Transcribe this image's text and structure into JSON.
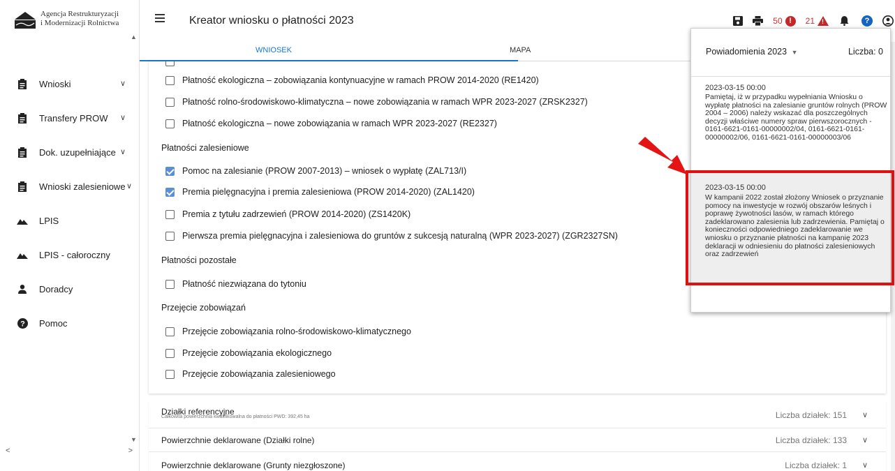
{
  "sidebar": {
    "logo_line1": "Agencja Restrukturyzacji",
    "logo_line2": "i Modernizacji Rolnictwa",
    "items": [
      {
        "label": "Wnioski",
        "icon": "clipboard-icon",
        "has_chevron": true
      },
      {
        "label": "Transfery PROW",
        "icon": "clipboard-icon",
        "has_chevron": true
      },
      {
        "label": "Dok. uzupełniające",
        "icon": "clipboard-icon",
        "has_chevron": true
      },
      {
        "label": "Wnioski zalesieniowe",
        "icon": "clipboard-icon",
        "has_chevron": true
      },
      {
        "label": "LPIS",
        "icon": "terrain-icon",
        "has_chevron": false
      },
      {
        "label": "LPIS - całoroczny",
        "icon": "terrain-icon",
        "has_chevron": false
      },
      {
        "label": "Doradcy",
        "icon": "person-icon",
        "has_chevron": false
      },
      {
        "label": "Pomoc",
        "icon": "help-icon",
        "has_chevron": false
      }
    ]
  },
  "header": {
    "title": "Kreator wniosku o płatności 2023",
    "errors_count": "50",
    "warnings_count": "21"
  },
  "tabs": {
    "wniosek": "WNIOSEK",
    "mapa": "MAPA"
  },
  "form": {
    "options_top": [
      {
        "label": "Płatność ekologiczna – zobowiązania kontynuacyjne w ramach PROW 2014-2020 (RE1420)",
        "checked": false
      },
      {
        "label": "Płatność rolno-środowiskowo-klimatyczna – nowe zobowiązania w ramach WPR 2023-2027 (ZRSK2327)",
        "checked": false
      },
      {
        "label": "Płatność ekologiczna – nowe zobowiązania w ramach WPR 2023-2027 (RE2327)",
        "checked": false
      }
    ],
    "section_zalesieniowe": "Płatności zalesieniowe",
    "options_zalesieniowe": [
      {
        "label": "Pomoc na zalesianie (PROW 2007-2013) – wniosek o wypłatę (ZAL713/I)",
        "checked": true
      },
      {
        "label": "Premia pielęgnacyjna i premia zalesieniowa (PROW 2014-2020) (ZAL1420)",
        "checked": true
      },
      {
        "label": "Premia z tytułu zadrzewień (PROW 2014-2020) (ZS1420K)",
        "checked": false
      },
      {
        "label": "Pierwsza premia pielęgnacyjna i zalesieniowa do gruntów z sukcesją naturalną (WPR 2023-2027) (ZGR2327SN)",
        "checked": false
      }
    ],
    "section_pozostale": "Płatności pozostałe",
    "options_pozostale": [
      {
        "label": "Płatność niezwiązana do tytoniu",
        "checked": false
      }
    ],
    "section_przejecie": "Przejęcie zobowiązań",
    "options_przejecie": [
      {
        "label": "Przejęcie zobowiązania rolno-środowiskowo-klimatycznego",
        "checked": false
      },
      {
        "label": "Przejęcie zobowiązania ekologicznego",
        "checked": false
      },
      {
        "label": "Przejęcie zobowiązania zalesieniowego",
        "checked": false
      }
    ]
  },
  "panels": [
    {
      "title": "Działki referencyjne",
      "subtitle": "Całkowita powierzchnia kwalifikowalna do płatności PWD: 392,45 ha",
      "count": "Liczba działek: 151"
    },
    {
      "title": "Powierzchnie deklarowane (Działki rolne)",
      "subtitle": "",
      "count": "Liczba działek: 133"
    },
    {
      "title": "Powierzchnie deklarowane (Grunty niezgłoszone)",
      "subtitle": "",
      "count": "Liczba działek: 1"
    }
  ],
  "notifications": {
    "title": "Powiadomienia",
    "year": "2023",
    "count_label": "Liczba: 0",
    "items": [
      {
        "date": "2023-03-15 00:00",
        "text": "Pamiętaj, iż w przypadku wypełniania Wniosku o wypłatę płatności na zalesianie gruntów rolnych (PROW 2004 – 2006) należy wskazać dla poszczególnych decyzji właściwe numery spraw pierwszorocznych - 0161-6621-0161-00000002/04, 0161-6621-0161-00000002/06, 0161-6621-0161-00000003/06"
      },
      {
        "date": "2023-03-15 00:00",
        "text": "W kampanii 2022 został złożony Wniosek o przyznanie pomocy na inwestycje w rozwój obszarów leśnych i poprawę żywotności lasów, w ramach którego zadeklarowano zalesienia lub zadrzewienia. Pamiętaj o konieczności odpowiedniego zadeklarowanie we wniosku o przyznanie płatności na kampanię 2023 deklaracji w odniesieniu do płatności zalesieniowych oraz zadrzewień"
      }
    ]
  },
  "colors": {
    "accent": "#1976d2",
    "checkbox": "#5a8fd8",
    "alert_red": "#c62828",
    "highlight": "#e01010"
  }
}
